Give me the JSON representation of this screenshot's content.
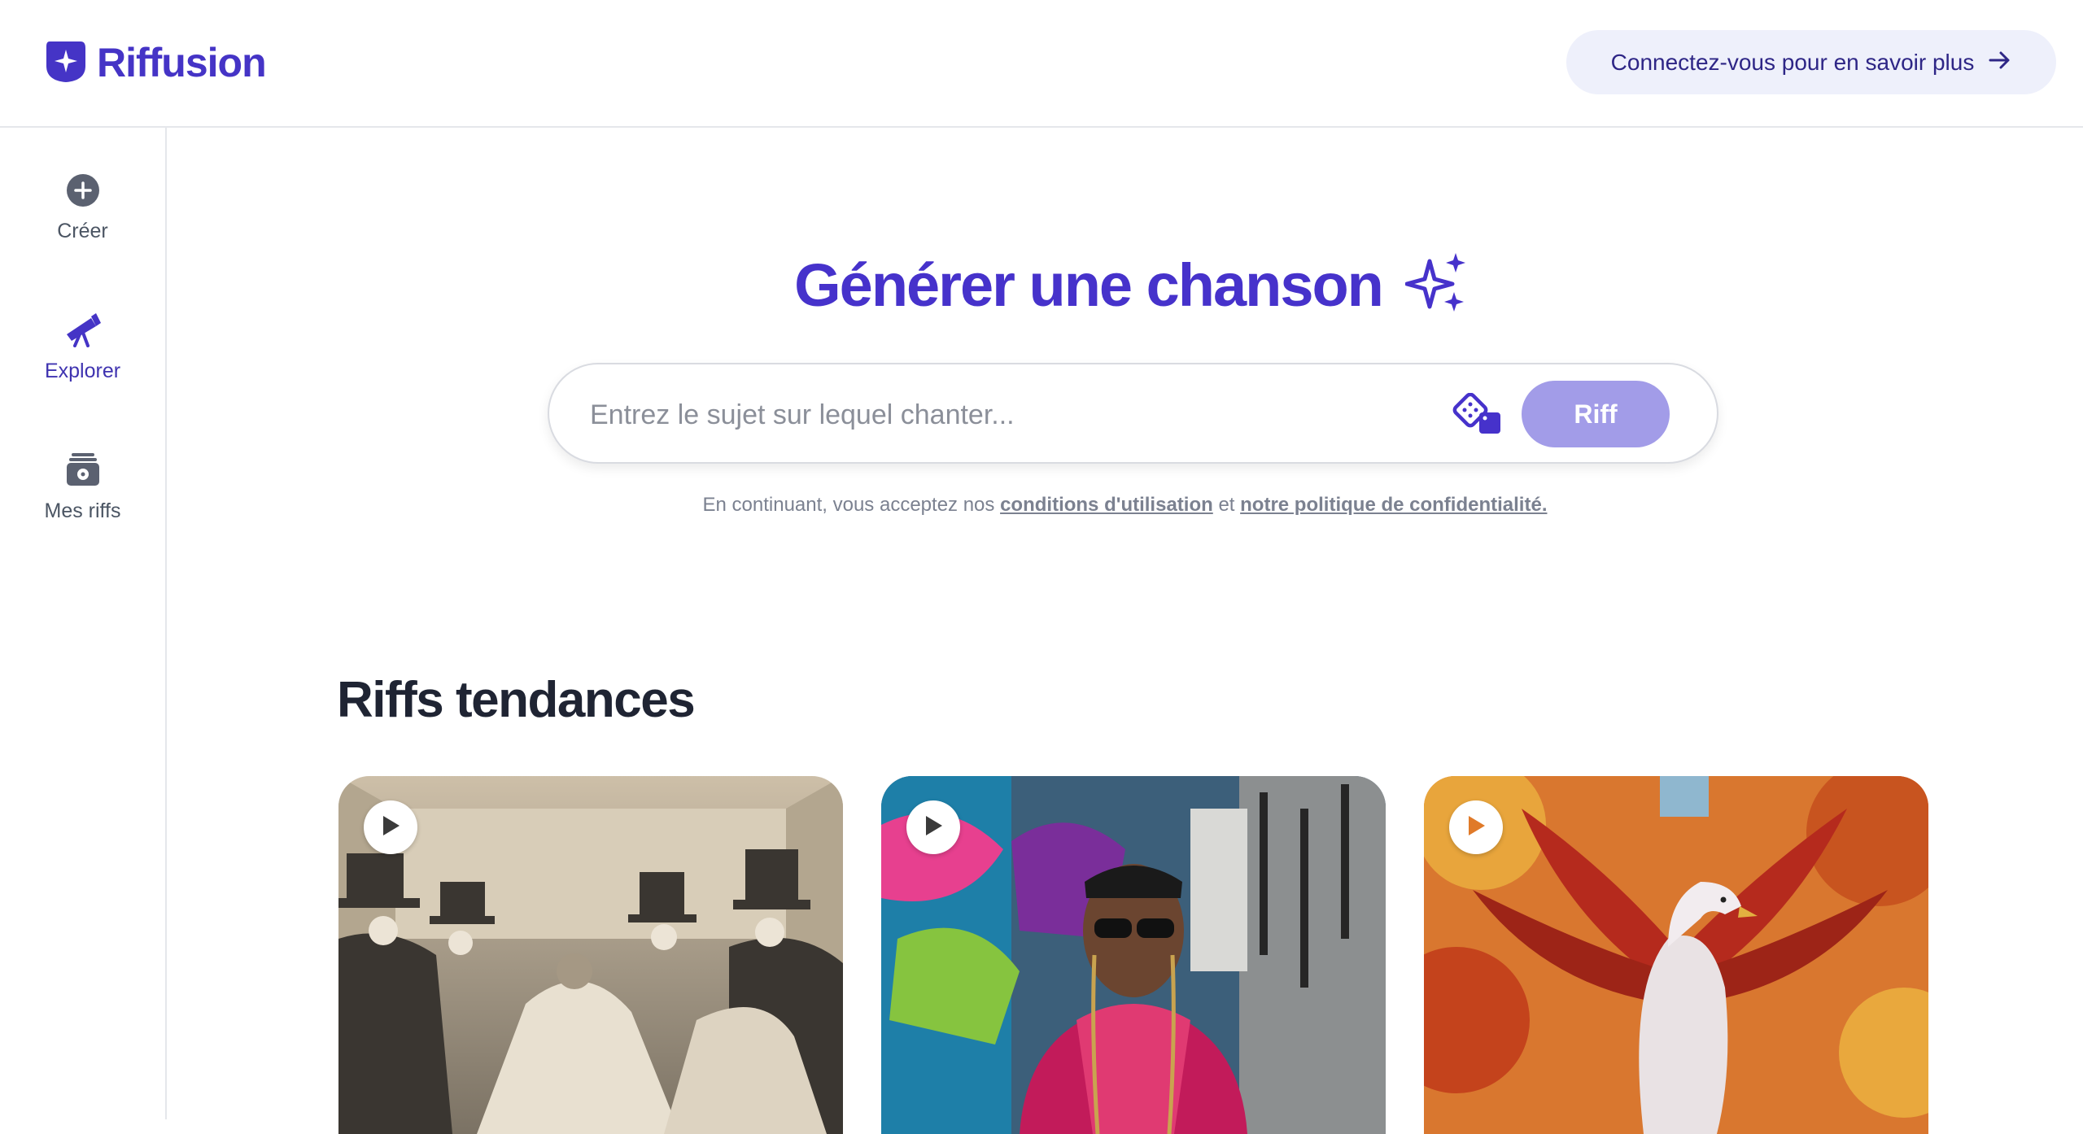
{
  "header": {
    "logo_text": "Riffusion",
    "login_label": "Connectez-vous pour en savoir plus"
  },
  "sidebar": {
    "items": [
      {
        "label": "Créer",
        "icon": "plus-circle-icon",
        "active": false
      },
      {
        "label": "Explorer",
        "icon": "telescope-icon",
        "active": true
      },
      {
        "label": "Mes riffs",
        "icon": "stack-icon",
        "active": false
      }
    ]
  },
  "hero": {
    "title": "Générer une chanson",
    "search_placeholder": "Entrez le sujet sur lequel chanter...",
    "submit_label": "Riff"
  },
  "terms": {
    "prefix": "En continuant, vous acceptez nos ",
    "terms_link": "conditions d'utilisation",
    "middle": " et ",
    "privacy_link": "notre politique de confidentialité."
  },
  "trending": {
    "title": "Riffs tendances",
    "cards": [
      {
        "image": "skeleton-ball-sketch"
      },
      {
        "image": "rapper-graffiti-portrait"
      },
      {
        "image": "phoenix-autumn-painting"
      }
    ]
  },
  "colors": {
    "brand": "#4632cb",
    "riff_button": "#a29ce8",
    "login_bg": "#eef0fb"
  }
}
